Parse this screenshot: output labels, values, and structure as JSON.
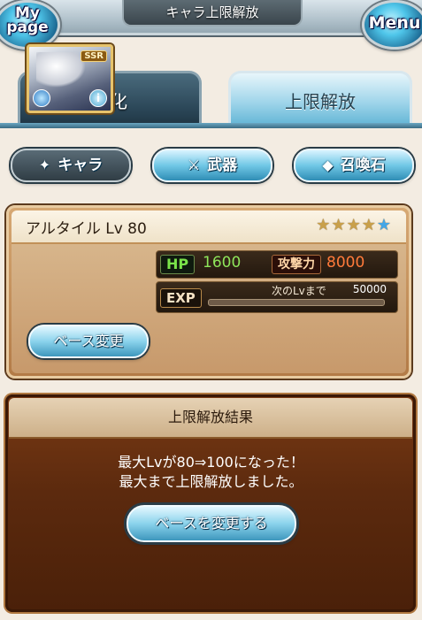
{
  "header": {
    "title": "キャラ上限解放",
    "mypage_label": "My page",
    "menu_label": "Menu"
  },
  "tabs": [
    {
      "label": "強化",
      "selected": false
    },
    {
      "label": "上限解放",
      "selected": true
    }
  ],
  "categories": [
    {
      "label": "キャラ",
      "icon": "character-icon",
      "selected": true
    },
    {
      "label": "武器",
      "icon": "weapon-icon",
      "selected": false
    },
    {
      "label": "召喚石",
      "icon": "summon-stone-icon",
      "selected": false
    }
  ],
  "character": {
    "name_level": "アルタイル Lv 80",
    "rarity": "SSR",
    "stars_filled": 4,
    "stars_total": 5,
    "stats": {
      "hp_label": "HP",
      "hp_value": "1600",
      "atk_label": "攻撃力",
      "atk_value": "8000",
      "exp_label": "EXP",
      "next_label": "次のLvまで",
      "next_value": "50000",
      "exp_progress": 0.0
    },
    "change_base_label": "ベース変更"
  },
  "result": {
    "title": "上限解放結果",
    "line1": "最大Lvが80⇒100になった！",
    "line2": "最大まで上限解放しました。",
    "button_label": "ベースを変更する"
  },
  "colors": {
    "accent_blue": "#5fb3d4",
    "panel_brown": "#5c2a0e",
    "hp_green": "#8ee55a",
    "atk_orange": "#ff7a3a"
  }
}
